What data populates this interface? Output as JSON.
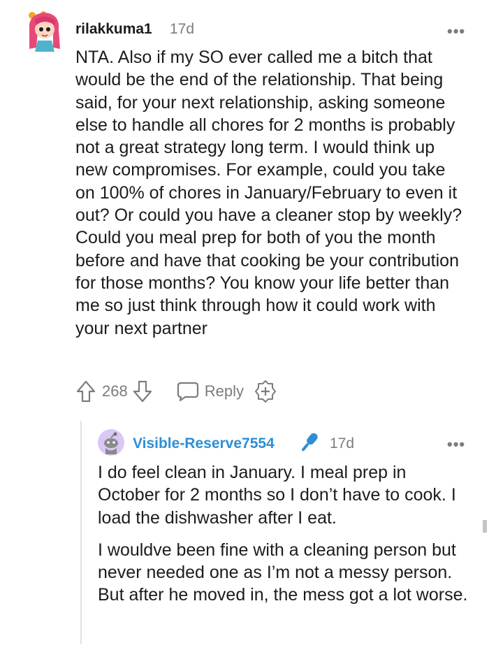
{
  "comment": {
    "username": "rilakkuma1",
    "age": "17d",
    "more_label": "•••",
    "body": "NTA. Also if my SO ever called me a bitch that would be the end of the relationship. That being said, for your next relationship, asking someone else to handle all chores for 2 months is probably not a great strategy long term. I would think up new compromises. For example, could you take on 100% of chores in January/February to even it out? Or could you have a cleaner stop by weekly? Could you meal prep for both of you the month before and have that cooking be your contribution for those months? You know your life better than me so just think through how it could work with your next partner",
    "votes": "268",
    "reply_label": "Reply"
  },
  "reply": {
    "username": "Visible-Reserve7554",
    "age": "17d",
    "more_label": "•••",
    "paragraphs": [
      "I do feel clean in January. I meal prep in October for 2 months so I don’t have to cook. I load the dishwasher after I eat.",
      "I wouldve been fine with a cleaning person but never needed one as I’m not a messy person. But after he moved in, the mess got a lot worse."
    ]
  },
  "colors": {
    "username_reply": "#2c8fd6",
    "muted": "#7c7c7c",
    "text": "#1c1c1c"
  },
  "icons": {
    "upvote": "arrow-up-icon",
    "downvote": "arrow-down-icon",
    "reply": "speech-bubble-icon",
    "award": "award-plus-icon",
    "mic": "microphone-icon",
    "more": "more-dots-icon"
  }
}
